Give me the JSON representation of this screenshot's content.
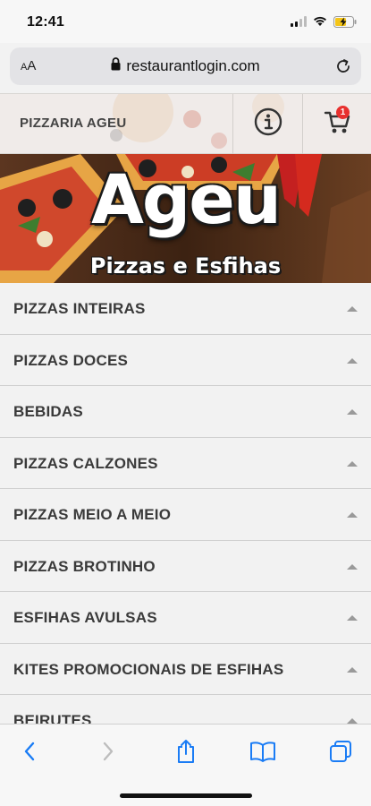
{
  "status": {
    "time": "12:41"
  },
  "browser": {
    "aa_label_small": "A",
    "aa_label_big": "A",
    "url": "restaurantlogin.com"
  },
  "header": {
    "title": "PIZZARIA AGEU",
    "cart_count": "1"
  },
  "banner": {
    "logo_main": "Ageu",
    "logo_sub": "Pizzas e Esfihas"
  },
  "categories": [
    {
      "label": "PIZZAS INTEIRAS"
    },
    {
      "label": "PIZZAS DOCES"
    },
    {
      "label": "BEBIDAS"
    },
    {
      "label": "PIZZAS CALZONES"
    },
    {
      "label": "PIZZAS MEIO A MEIO"
    },
    {
      "label": "PIZZAS BROTINHO"
    },
    {
      "label": "ESFIHAS AVULSAS"
    },
    {
      "label": "KITES PROMOCIONAIS DE ESFIHAS"
    },
    {
      "label": "BEIRUTES"
    }
  ],
  "colors": {
    "accent_blue": "#1a7cf5",
    "badge_red": "#e8302e"
  }
}
